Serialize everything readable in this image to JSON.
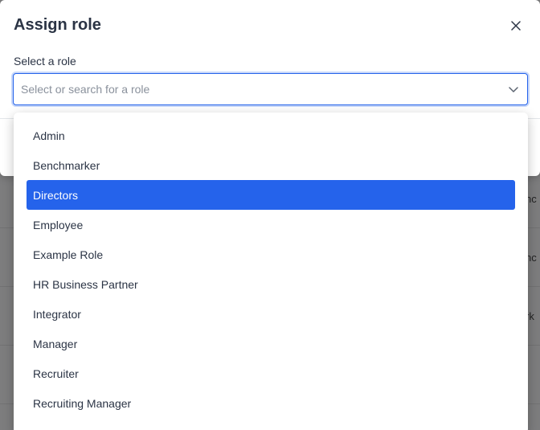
{
  "background": {
    "snippets": [
      "nc",
      "nc",
      "rk"
    ]
  },
  "modal": {
    "title": "Assign role",
    "close_icon": "close-icon",
    "field_label": "Select a role",
    "select_placeholder": "Select or search for a role",
    "chevron_icon": "chevron-down-icon"
  },
  "dropdown": {
    "options": [
      {
        "label": "Admin",
        "selected": false
      },
      {
        "label": "Benchmarker",
        "selected": false
      },
      {
        "label": "Directors",
        "selected": true
      },
      {
        "label": "Employee",
        "selected": false
      },
      {
        "label": "Example Role",
        "selected": false
      },
      {
        "label": "HR Business Partner",
        "selected": false
      },
      {
        "label": "Integrator",
        "selected": false
      },
      {
        "label": "Manager",
        "selected": false
      },
      {
        "label": "Recruiter",
        "selected": false
      },
      {
        "label": "Recruiting Manager",
        "selected": false
      }
    ]
  },
  "colors": {
    "accent": "#2563eb",
    "text": "#2b3445",
    "placeholder": "#8a919c",
    "overlay": "#7f7f80"
  }
}
